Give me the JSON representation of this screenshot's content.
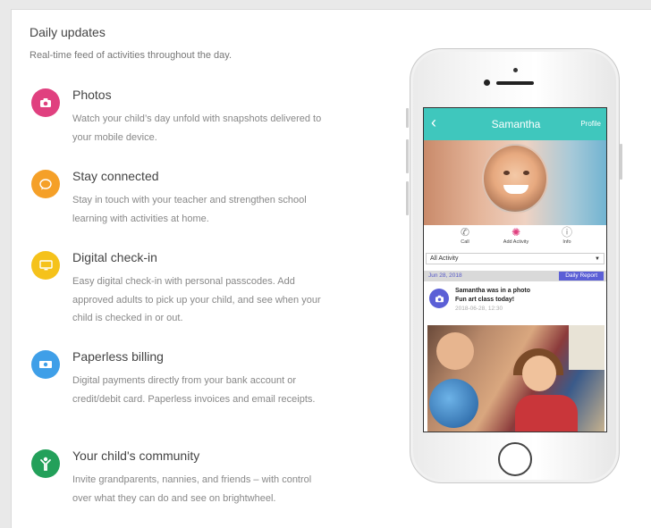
{
  "header": {
    "title": "Daily updates",
    "subtitle": "Real-time feed of activities throughout the day."
  },
  "features": [
    {
      "title": "Photos",
      "description": "Watch your child’s day unfold with snapshots delivered to your mobile device.",
      "icon": "camera-icon",
      "color": "#e0407f"
    },
    {
      "title": "Stay connected",
      "description": "Stay in touch with your teacher and strengthen school learning with activities at home.",
      "icon": "chat-bubble-icon",
      "color": "#f5a028"
    },
    {
      "title": "Digital check-in",
      "description": "Easy digital check-in with personal passcodes. Add approved adults to pick up your child, and see when your child is checked in or out.",
      "icon": "tablet-icon",
      "color": "#f5c21b"
    },
    {
      "title": "Paperless billing",
      "description": "Digital payments directly from your bank account or credit/debit card. Paperless invoices and email receipts.",
      "icon": "money-bill-icon",
      "color": "#3f9fe8"
    },
    {
      "title": "Your child's community",
      "description": "Invite grandparents, nannies, and friends – with control over what they can do and see on brightwheel.",
      "icon": "person-icon",
      "color": "#23a05a"
    }
  ],
  "phone": {
    "app_title": "Samantha",
    "back_glyph": "‹",
    "profile_label": "Profile",
    "actions": [
      {
        "label": "Call",
        "icon": "phone-icon",
        "glyph": "✆"
      },
      {
        "label": "Add Activity",
        "icon": "activity-pinwheel-icon",
        "glyph": "✺"
      },
      {
        "label": "Info",
        "icon": "info-icon",
        "glyph": "ⓘ"
      }
    ],
    "filter_value": "All Activity",
    "date": "Jun 28, 2018",
    "daily_report_label": "Daily Report",
    "post": {
      "line1": "Samantha was in a photo",
      "line2": "Fun art class today!",
      "timestamp": "2018-06-28, 12:30"
    },
    "accent_color": "#3fc7bd"
  }
}
